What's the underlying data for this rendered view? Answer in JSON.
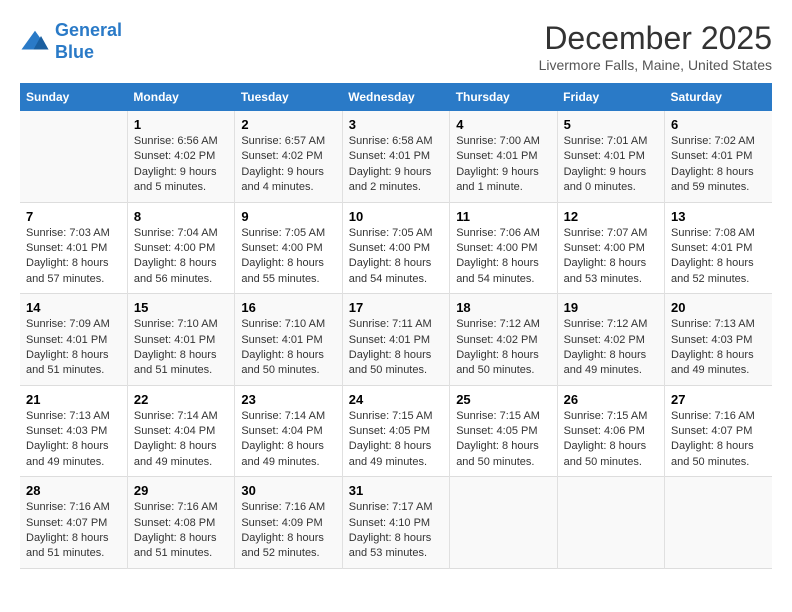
{
  "header": {
    "logo_line1": "General",
    "logo_line2": "Blue",
    "month_year": "December 2025",
    "location": "Livermore Falls, Maine, United States"
  },
  "weekdays": [
    "Sunday",
    "Monday",
    "Tuesday",
    "Wednesday",
    "Thursday",
    "Friday",
    "Saturday"
  ],
  "weeks": [
    [
      {
        "day": "",
        "info": ""
      },
      {
        "day": "1",
        "info": "Sunrise: 6:56 AM\nSunset: 4:02 PM\nDaylight: 9 hours\nand 5 minutes."
      },
      {
        "day": "2",
        "info": "Sunrise: 6:57 AM\nSunset: 4:02 PM\nDaylight: 9 hours\nand 4 minutes."
      },
      {
        "day": "3",
        "info": "Sunrise: 6:58 AM\nSunset: 4:01 PM\nDaylight: 9 hours\nand 2 minutes."
      },
      {
        "day": "4",
        "info": "Sunrise: 7:00 AM\nSunset: 4:01 PM\nDaylight: 9 hours\nand 1 minute."
      },
      {
        "day": "5",
        "info": "Sunrise: 7:01 AM\nSunset: 4:01 PM\nDaylight: 9 hours\nand 0 minutes."
      },
      {
        "day": "6",
        "info": "Sunrise: 7:02 AM\nSunset: 4:01 PM\nDaylight: 8 hours\nand 59 minutes."
      }
    ],
    [
      {
        "day": "7",
        "info": "Sunrise: 7:03 AM\nSunset: 4:01 PM\nDaylight: 8 hours\nand 57 minutes."
      },
      {
        "day": "8",
        "info": "Sunrise: 7:04 AM\nSunset: 4:00 PM\nDaylight: 8 hours\nand 56 minutes."
      },
      {
        "day": "9",
        "info": "Sunrise: 7:05 AM\nSunset: 4:00 PM\nDaylight: 8 hours\nand 55 minutes."
      },
      {
        "day": "10",
        "info": "Sunrise: 7:05 AM\nSunset: 4:00 PM\nDaylight: 8 hours\nand 54 minutes."
      },
      {
        "day": "11",
        "info": "Sunrise: 7:06 AM\nSunset: 4:00 PM\nDaylight: 8 hours\nand 54 minutes."
      },
      {
        "day": "12",
        "info": "Sunrise: 7:07 AM\nSunset: 4:00 PM\nDaylight: 8 hours\nand 53 minutes."
      },
      {
        "day": "13",
        "info": "Sunrise: 7:08 AM\nSunset: 4:01 PM\nDaylight: 8 hours\nand 52 minutes."
      }
    ],
    [
      {
        "day": "14",
        "info": "Sunrise: 7:09 AM\nSunset: 4:01 PM\nDaylight: 8 hours\nand 51 minutes."
      },
      {
        "day": "15",
        "info": "Sunrise: 7:10 AM\nSunset: 4:01 PM\nDaylight: 8 hours\nand 51 minutes."
      },
      {
        "day": "16",
        "info": "Sunrise: 7:10 AM\nSunset: 4:01 PM\nDaylight: 8 hours\nand 50 minutes."
      },
      {
        "day": "17",
        "info": "Sunrise: 7:11 AM\nSunset: 4:01 PM\nDaylight: 8 hours\nand 50 minutes."
      },
      {
        "day": "18",
        "info": "Sunrise: 7:12 AM\nSunset: 4:02 PM\nDaylight: 8 hours\nand 50 minutes."
      },
      {
        "day": "19",
        "info": "Sunrise: 7:12 AM\nSunset: 4:02 PM\nDaylight: 8 hours\nand 49 minutes."
      },
      {
        "day": "20",
        "info": "Sunrise: 7:13 AM\nSunset: 4:03 PM\nDaylight: 8 hours\nand 49 minutes."
      }
    ],
    [
      {
        "day": "21",
        "info": "Sunrise: 7:13 AM\nSunset: 4:03 PM\nDaylight: 8 hours\nand 49 minutes."
      },
      {
        "day": "22",
        "info": "Sunrise: 7:14 AM\nSunset: 4:04 PM\nDaylight: 8 hours\nand 49 minutes."
      },
      {
        "day": "23",
        "info": "Sunrise: 7:14 AM\nSunset: 4:04 PM\nDaylight: 8 hours\nand 49 minutes."
      },
      {
        "day": "24",
        "info": "Sunrise: 7:15 AM\nSunset: 4:05 PM\nDaylight: 8 hours\nand 49 minutes."
      },
      {
        "day": "25",
        "info": "Sunrise: 7:15 AM\nSunset: 4:05 PM\nDaylight: 8 hours\nand 50 minutes."
      },
      {
        "day": "26",
        "info": "Sunrise: 7:15 AM\nSunset: 4:06 PM\nDaylight: 8 hours\nand 50 minutes."
      },
      {
        "day": "27",
        "info": "Sunrise: 7:16 AM\nSunset: 4:07 PM\nDaylight: 8 hours\nand 50 minutes."
      }
    ],
    [
      {
        "day": "28",
        "info": "Sunrise: 7:16 AM\nSunset: 4:07 PM\nDaylight: 8 hours\nand 51 minutes."
      },
      {
        "day": "29",
        "info": "Sunrise: 7:16 AM\nSunset: 4:08 PM\nDaylight: 8 hours\nand 51 minutes."
      },
      {
        "day": "30",
        "info": "Sunrise: 7:16 AM\nSunset: 4:09 PM\nDaylight: 8 hours\nand 52 minutes."
      },
      {
        "day": "31",
        "info": "Sunrise: 7:17 AM\nSunset: 4:10 PM\nDaylight: 8 hours\nand 53 minutes."
      },
      {
        "day": "",
        "info": ""
      },
      {
        "day": "",
        "info": ""
      },
      {
        "day": "",
        "info": ""
      }
    ]
  ]
}
